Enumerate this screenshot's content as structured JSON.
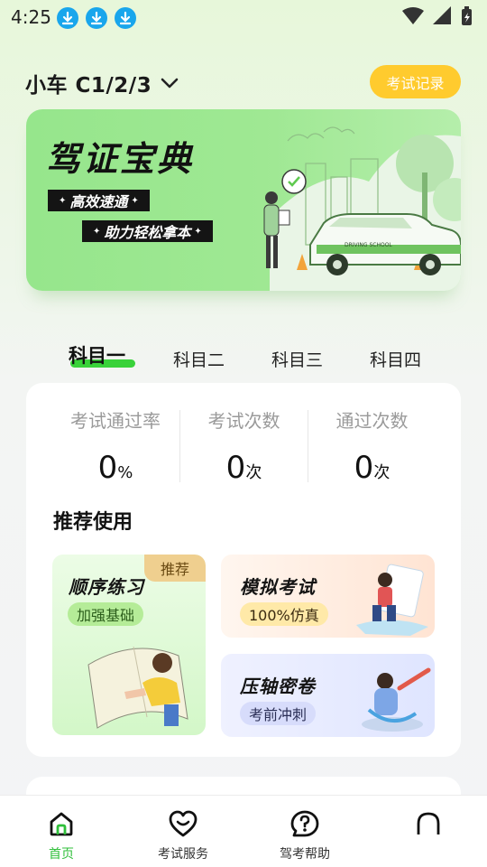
{
  "status_bar": {
    "time": "4:25",
    "icons": [
      "download-icon",
      "download-icon",
      "download-icon",
      "wifi-icon",
      "signal-icon",
      "battery-charging-icon"
    ]
  },
  "header": {
    "vehicle_type": "小车 C1/2/3",
    "exam_record_label": "考试记录"
  },
  "banner": {
    "title": "驾证宝典",
    "tag1": "高效速通",
    "tag2": "助力轻松拿本",
    "car_text": "DRIVING SCHOOL"
  },
  "tabs": [
    {
      "label": "科目一",
      "active": true
    },
    {
      "label": "科目二",
      "active": false
    },
    {
      "label": "科目三",
      "active": false
    },
    {
      "label": "科目四",
      "active": false
    }
  ],
  "stats": [
    {
      "label": "考试通过率",
      "value": "0",
      "unit": "%"
    },
    {
      "label": "考试次数",
      "value": "0",
      "unit": "次"
    },
    {
      "label": "通过次数",
      "value": "0",
      "unit": "次"
    }
  ],
  "recommend": {
    "section_title": "推荐使用",
    "badge": "推荐",
    "practice": {
      "title": "顺序练习",
      "chip": "加强基础"
    },
    "mock": {
      "title": "模拟考试",
      "chip": "100%仿真"
    },
    "secret": {
      "title": "压轴密卷",
      "chip": "考前冲刺"
    }
  },
  "nav": [
    {
      "label": "首页",
      "icon": "home-icon",
      "active": true
    },
    {
      "label": "考试服务",
      "icon": "heart-smile-icon",
      "active": false
    },
    {
      "label": "驾考帮助",
      "icon": "help-bubble-icon",
      "active": false
    },
    {
      "label": "",
      "icon": "profile-icon",
      "active": false
    }
  ],
  "colors": {
    "accent_green": "#2fbf3a",
    "tab_underline": "#39d23a",
    "record_button": "#ffcb2e",
    "banner_green": "#9fe893",
    "recommend_badge": "#efcf8f"
  }
}
